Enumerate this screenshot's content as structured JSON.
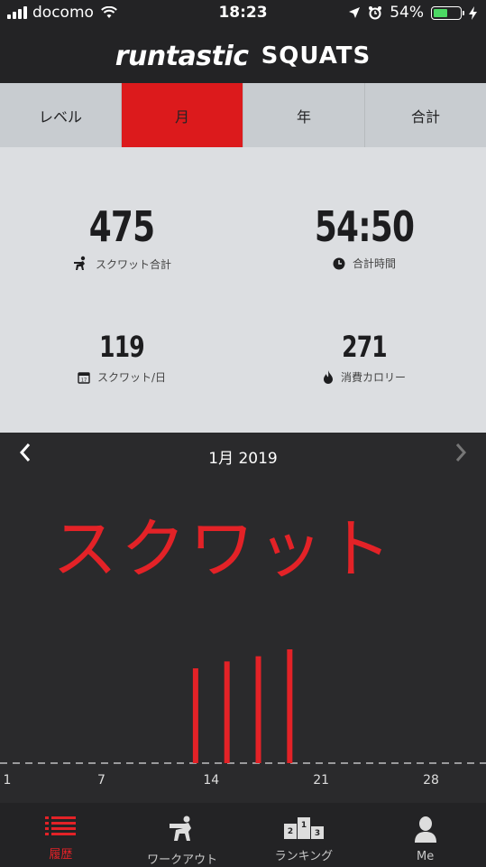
{
  "status_bar": {
    "carrier": "docomo",
    "time": "18:23",
    "battery": "54%",
    "battery_level": 0.54
  },
  "header": {
    "brand": "runtastic",
    "app_name": "SQUATS"
  },
  "tabs": [
    {
      "label": "レベル",
      "active": false
    },
    {
      "label": "月",
      "active": true
    },
    {
      "label": "年",
      "active": false
    },
    {
      "label": "合計",
      "active": false
    }
  ],
  "stats": {
    "total_squats": {
      "value": "475",
      "label": "スクワット合計",
      "icon": "squat-icon"
    },
    "total_time": {
      "value": "54:50",
      "label": "合計時間",
      "icon": "clock-icon"
    },
    "squats_per_day": {
      "value": "119",
      "label": "スクワット/日",
      "icon": "calendar-icon"
    },
    "calories": {
      "value": "271",
      "label": "消費カロリー",
      "icon": "flame-icon"
    }
  },
  "chart_header": {
    "month": "1月 2019"
  },
  "chart_data": {
    "type": "bar",
    "title": "スクワット",
    "x": [
      13,
      15,
      17,
      19
    ],
    "values": [
      110,
      118,
      124,
      132
    ],
    "x_ticks": [
      "1",
      "7",
      "14",
      "21",
      "28"
    ],
    "x_tick_values": [
      1,
      7,
      14,
      21,
      28
    ],
    "xlim": [
      1,
      31
    ],
    "bar_color": "#e32227"
  },
  "tabbar": [
    {
      "label": "履歴",
      "icon": "history-list-icon",
      "active": true
    },
    {
      "label": "ワークアウト",
      "icon": "squat-icon",
      "active": false
    },
    {
      "label": "ランキング",
      "icon": "podium-icon",
      "active": false
    },
    {
      "label": "Me",
      "icon": "user-icon",
      "active": false
    }
  ],
  "colors": {
    "accent": "#dc1a1c",
    "bar": "#e32227",
    "dark": "#232325",
    "panel": "#dcdee1"
  }
}
